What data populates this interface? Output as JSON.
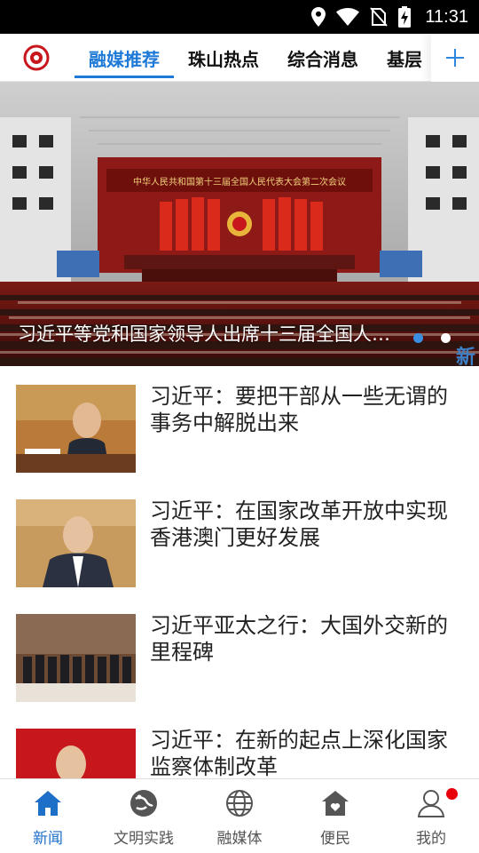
{
  "status_bar": {
    "time": "11:31",
    "icons": [
      "location-icon",
      "wifi-icon",
      "no-sim-icon",
      "battery-charging-icon"
    ]
  },
  "tabs": {
    "items": [
      {
        "label": "融媒推荐",
        "active": true
      },
      {
        "label": "珠山热点",
        "active": false
      },
      {
        "label": "综合消息",
        "active": false
      },
      {
        "label": "基层",
        "active": false
      }
    ],
    "add_icon": "plus-icon",
    "accent": "#1e7ad6"
  },
  "banner": {
    "header_text": "中华人民共和国第十三届全国人民代表大会第二次会议",
    "caption": "习近平等党和国家领导人出席十三届全国人大二次会议闭幕会",
    "watermark": "新",
    "slide_count": 2,
    "active_slide": 1
  },
  "news": [
    {
      "title": "习近平：要把干部从一些无谓的事务中解脱出来"
    },
    {
      "title": "习近平：在国家改革开放中实现香港澳门更好发展"
    },
    {
      "title": "习近平亚太之行：大国外交新的里程碑"
    },
    {
      "title": "习近平：在新的起点上深化国家监察体制改革"
    }
  ],
  "bottom_nav": [
    {
      "label": "新闻",
      "icon": "home-icon",
      "active": true
    },
    {
      "label": "文明实践",
      "icon": "civilization-icon",
      "active": false
    },
    {
      "label": "融媒体",
      "icon": "globe-icon",
      "active": false
    },
    {
      "label": "便民",
      "icon": "house-heart-icon",
      "active": false
    },
    {
      "label": "我的",
      "icon": "user-icon",
      "active": false,
      "badge": true
    }
  ],
  "colors": {
    "nav_active": "#1e6fc8",
    "badge": "#e8000b"
  }
}
